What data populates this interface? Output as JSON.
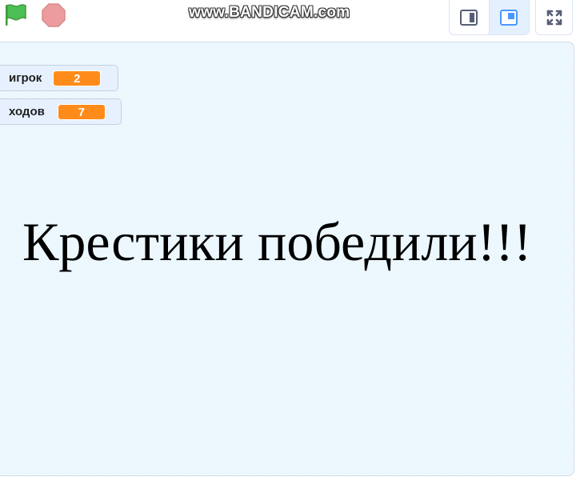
{
  "toolbar": {
    "green_flag_icon": "green-flag-icon",
    "stop_icon": "stop-sign-icon",
    "watermark": "www.BANDICAM.com",
    "layout_buttons": [
      {
        "name": "small-stage-button",
        "icon": "small-stage-icon",
        "selected": false
      },
      {
        "name": "normal-stage-button",
        "icon": "normal-stage-icon",
        "selected": true
      }
    ],
    "fullscreen_icon": "fullscreen-icon"
  },
  "stage": {
    "monitors": [
      {
        "label": "игрок",
        "value": "2"
      },
      {
        "label": "ходов",
        "value": "7"
      }
    ],
    "message": "Крестики победили!!!"
  },
  "colors": {
    "flag_green": "#4cbf56",
    "stop_red": "#ec9c9c",
    "monitor_orange": "#ff8c1a",
    "stage_bg": "#e8f6fd",
    "selected_layout": "#4c97ff"
  }
}
